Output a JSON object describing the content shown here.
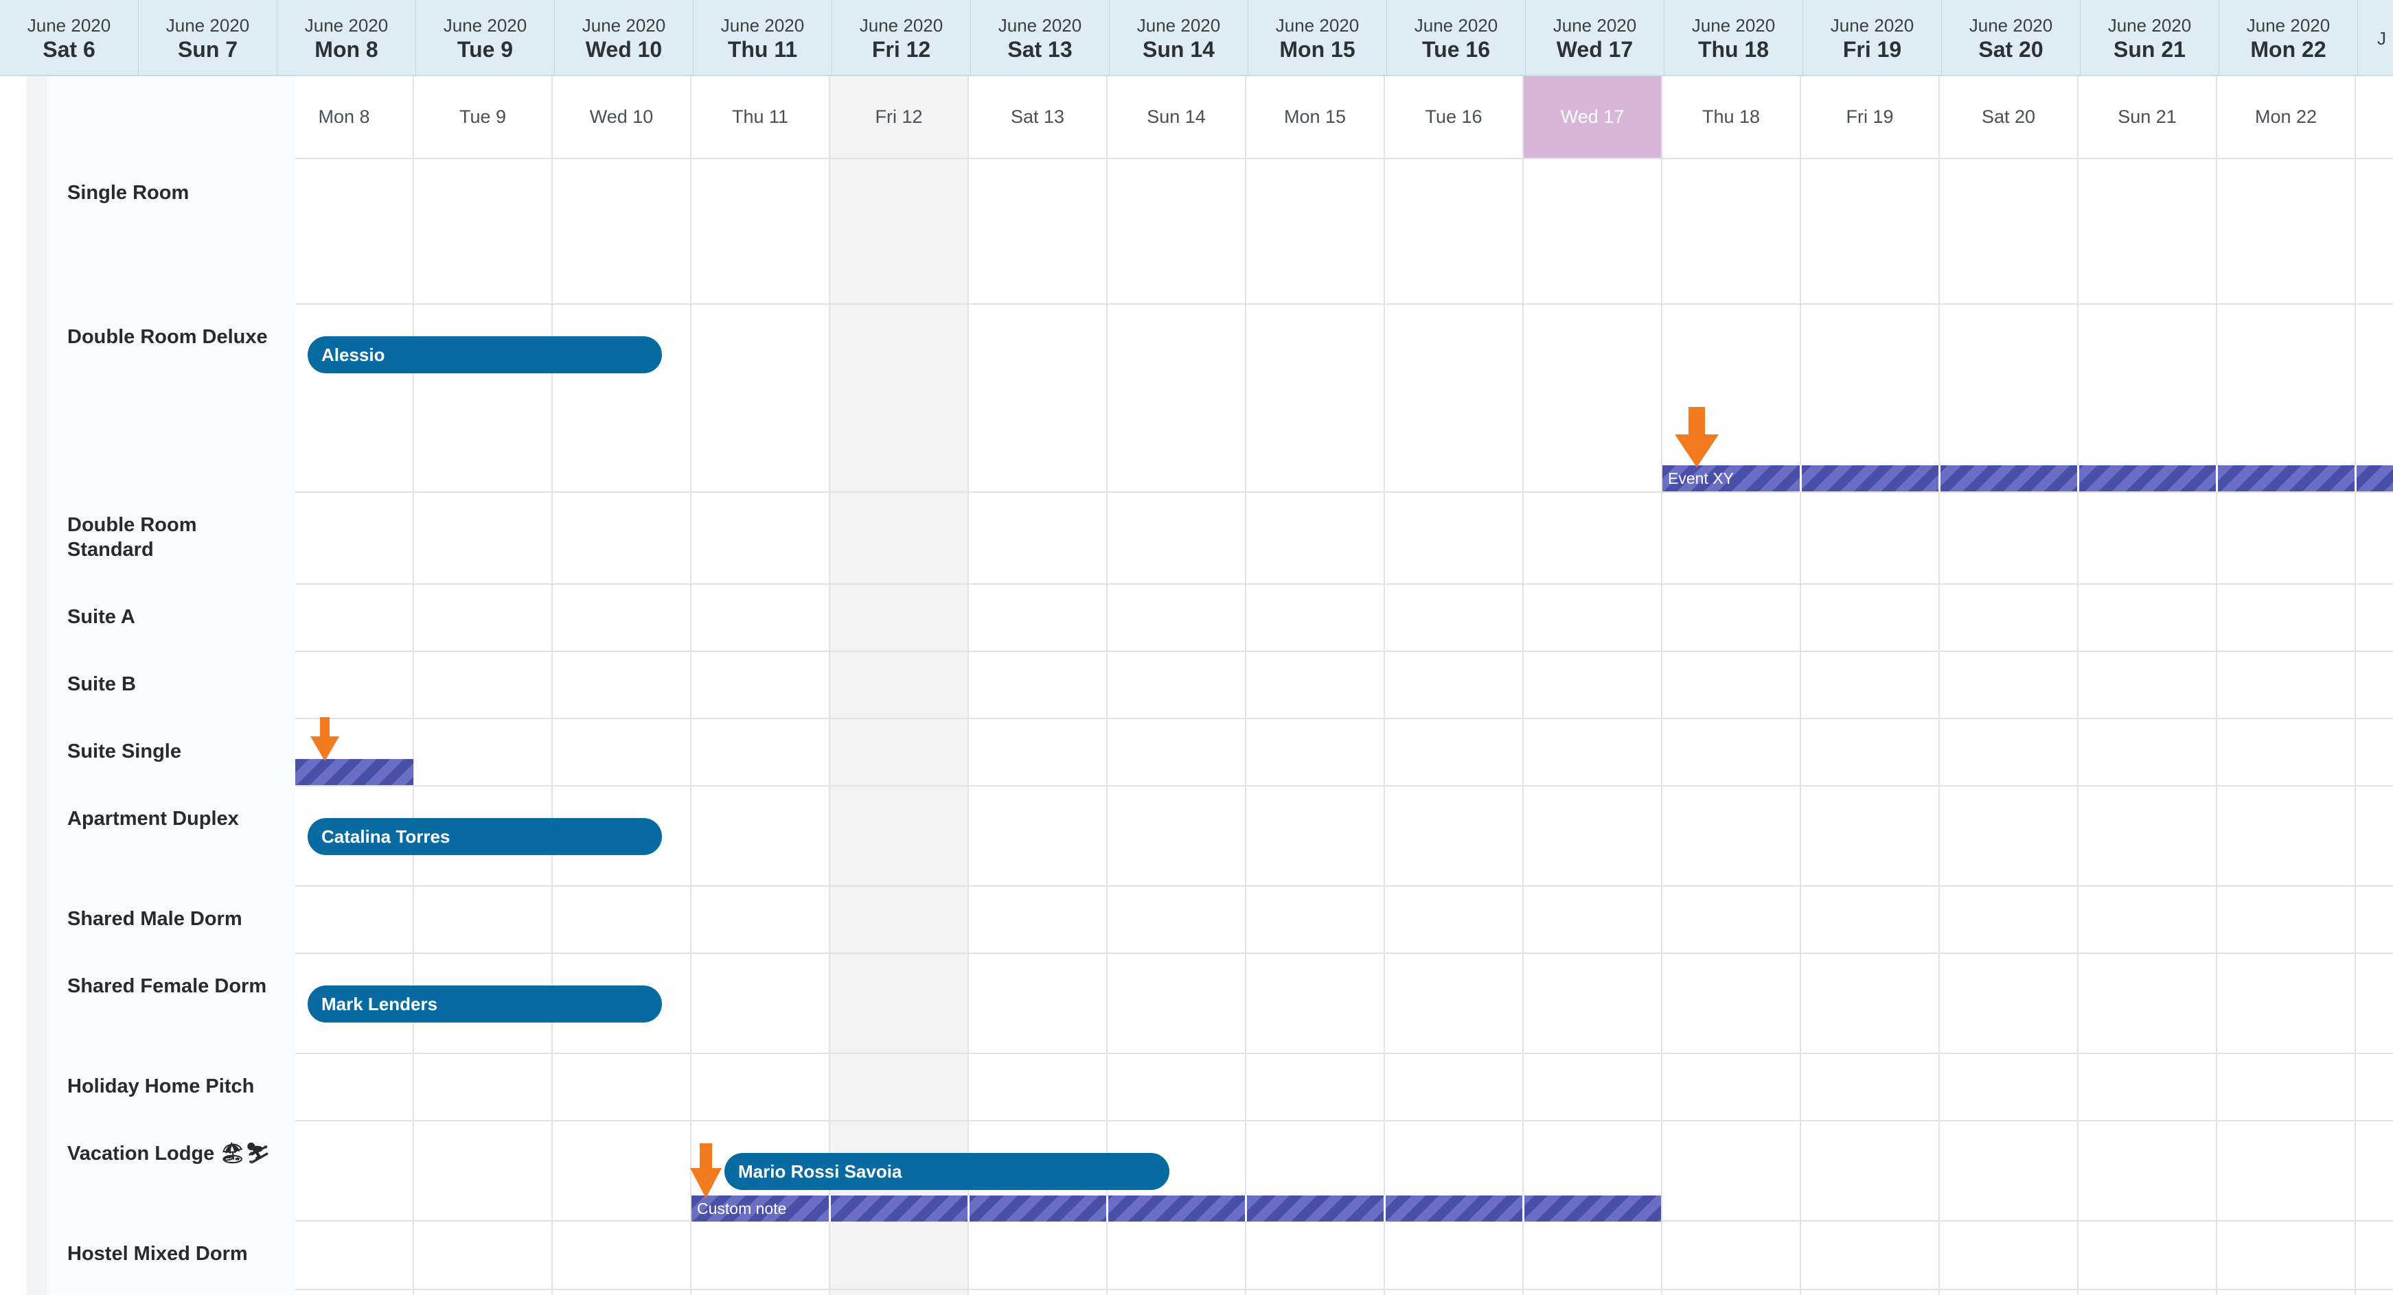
{
  "header": {
    "columns": [
      {
        "month": "June 2020",
        "day": "Sat 6"
      },
      {
        "month": "June 2020",
        "day": "Sun 7"
      },
      {
        "month": "June 2020",
        "day": "Mon 8"
      },
      {
        "month": "June 2020",
        "day": "Tue 9"
      },
      {
        "month": "June 2020",
        "day": "Wed 10"
      },
      {
        "month": "June 2020",
        "day": "Thu 11"
      },
      {
        "month": "June 2020",
        "day": "Fri 12"
      },
      {
        "month": "June 2020",
        "day": "Sat 13"
      },
      {
        "month": "June 2020",
        "day": "Sun 14"
      },
      {
        "month": "June 2020",
        "day": "Mon 15"
      },
      {
        "month": "June 2020",
        "day": "Tue 16"
      },
      {
        "month": "June 2020",
        "day": "Wed 17"
      },
      {
        "month": "June 2020",
        "day": "Thu 18"
      },
      {
        "month": "June 2020",
        "day": "Fri 19"
      },
      {
        "month": "June 2020",
        "day": "Sat 20"
      },
      {
        "month": "June 2020",
        "day": "Sun 21"
      },
      {
        "month": "June 2020",
        "day": "Mon 22"
      },
      {
        "month": "J",
        "day": ""
      }
    ]
  },
  "calendar": {
    "days": [
      "Mon 8",
      "Tue 9",
      "Wed 10",
      "Thu 11",
      "Fri 12",
      "Sat 13",
      "Sun 14",
      "Mon 15",
      "Tue 16",
      "Wed 17",
      "Thu 18",
      "Fri 19",
      "Sat 20",
      "Sun 21",
      "Mon 22"
    ],
    "today": "Wed 17",
    "weekend_shaded": "Fri 12"
  },
  "rooms": [
    {
      "name": "Single Room"
    },
    {
      "name": "Double Room Deluxe"
    },
    {
      "name": "Double Room Standard"
    },
    {
      "name": "Suite A"
    },
    {
      "name": "Suite B"
    },
    {
      "name": "Suite Single"
    },
    {
      "name": "Apartment Duplex"
    },
    {
      "name": "Shared Male Dorm"
    },
    {
      "name": "Shared Female Dorm"
    },
    {
      "name": "Holiday Home Pitch"
    },
    {
      "name": "Vacation Lodge 🏖⛷"
    },
    {
      "name": "Hostel Mixed Dorm"
    }
  ],
  "bookings": [
    {
      "guest": "Alessio",
      "room": "Double Room Deluxe",
      "from": "Mon 8",
      "to": "Wed 10"
    },
    {
      "guest": "Catalina Torres",
      "room": "Apartment Duplex",
      "from": "Mon 8",
      "to": "Wed 10"
    },
    {
      "guest": "Mark Lenders",
      "room": "Shared Female Dorm",
      "from": "Mon 8",
      "to": "Wed 10"
    },
    {
      "guest": "Mario Rossi Savoia",
      "room": "Vacation Lodge 🏖⛷",
      "from": "Thu 11",
      "to": "Sun 14"
    }
  ],
  "events": [
    {
      "label": "Event XY",
      "room": "Double Room Deluxe",
      "from": "Thu 18",
      "to": "Mon 22+"
    },
    {
      "label": "",
      "room": "Suite Single",
      "from": "Mon 8",
      "to": "Mon 8"
    },
    {
      "label": "Custom note",
      "room": "Vacation Lodge 🏖⛷",
      "from": "Thu 11",
      "to": "Wed 17"
    }
  ],
  "colors": {
    "header_bg": "#deedf5",
    "booking": "#076aa1",
    "event_stripe_dark": "#4a4fa7",
    "event_stripe_light": "#6a6fc4",
    "today": "#d8b6d8",
    "arrow": "#f47a20"
  },
  "icons": {
    "event_marker": "arrow-down-icon"
  }
}
